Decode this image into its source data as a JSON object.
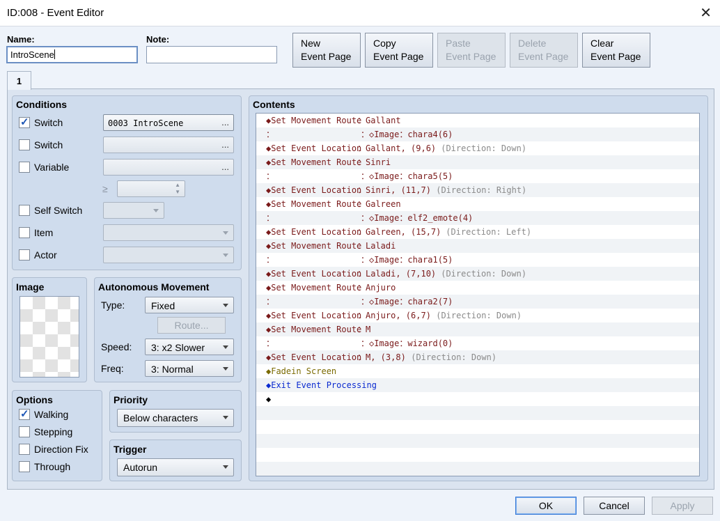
{
  "window": {
    "title": "ID:008 - Event Editor",
    "close_icon": "close-icon"
  },
  "header": {
    "name_label": "Name:",
    "name_value": "IntroScene",
    "note_label": "Note:",
    "note_value": "",
    "buttons": {
      "new": [
        "New",
        "Event Page"
      ],
      "copy": [
        "Copy",
        "Event Page"
      ],
      "paste": [
        "Paste",
        "Event Page"
      ],
      "delete": [
        "Delete",
        "Event Page"
      ],
      "clear": [
        "Clear",
        "Event Page"
      ]
    }
  },
  "tabs": [
    {
      "label": "1"
    }
  ],
  "conditions": {
    "title": "Conditions",
    "switch1": {
      "label": "Switch",
      "checked": true,
      "value": "0003 IntroScene"
    },
    "switch2": {
      "label": "Switch",
      "checked": false,
      "value": ""
    },
    "variable": {
      "label": "Variable",
      "checked": false,
      "value": "",
      "op": "≥",
      "number": ""
    },
    "self_switch": {
      "label": "Self Switch",
      "checked": false,
      "value": ""
    },
    "item": {
      "label": "Item",
      "checked": false,
      "value": ""
    },
    "actor": {
      "label": "Actor",
      "checked": false,
      "value": ""
    },
    "ellipsis": "..."
  },
  "image": {
    "title": "Image"
  },
  "autonomous": {
    "title": "Autonomous Movement",
    "type_label": "Type:",
    "type_value": "Fixed",
    "route_label": "Route...",
    "speed_label": "Speed:",
    "speed_value": "3: x2 Slower",
    "freq_label": "Freq:",
    "freq_value": "3: Normal"
  },
  "options": {
    "title": "Options",
    "walking": {
      "label": "Walking",
      "checked": true
    },
    "stepping": {
      "label": "Stepping",
      "checked": false
    },
    "direction_fix": {
      "label": "Direction Fix",
      "checked": false
    },
    "through": {
      "label": "Through",
      "checked": false
    }
  },
  "priority": {
    "title": "Priority",
    "value": "Below characters"
  },
  "trigger": {
    "title": "Trigger",
    "value": "Autorun"
  },
  "contents": {
    "title": "Contents",
    "rows": [
      {
        "a": "◆Set Movement Route",
        "b": "：Gallant",
        "c": "",
        "color": "red"
      },
      {
        "a": "：",
        "b": "：◇Image：chara4(6)",
        "c": "",
        "color": "red",
        "indent": true
      },
      {
        "a": "◆Set Event Location",
        "b": "：Gallant, (9,6)",
        "c": " (Direction: Down)",
        "color": "red"
      },
      {
        "a": "◆Set Movement Route",
        "b": "：Sinri",
        "c": "",
        "color": "red"
      },
      {
        "a": "：",
        "b": "：◇Image：chara5(5)",
        "c": "",
        "color": "red",
        "indent": true
      },
      {
        "a": "◆Set Event Location",
        "b": "：Sinri, (11,7)",
        "c": " (Direction: Right)",
        "color": "red"
      },
      {
        "a": "◆Set Movement Route",
        "b": "：Galreen",
        "c": "",
        "color": "red"
      },
      {
        "a": "：",
        "b": "：◇Image：elf2_emote(4)",
        "c": "",
        "color": "red",
        "indent": true
      },
      {
        "a": "◆Set Event Location",
        "b": "：Galreen, (15,7)",
        "c": " (Direction: Left)",
        "color": "red"
      },
      {
        "a": "◆Set Movement Route",
        "b": "：Laladi",
        "c": "",
        "color": "red"
      },
      {
        "a": "：",
        "b": "：◇Image：chara1(5)",
        "c": "",
        "color": "red",
        "indent": true
      },
      {
        "a": "◆Set Event Location",
        "b": "：Laladi, (7,10)",
        "c": " (Direction: Down)",
        "color": "red"
      },
      {
        "a": "◆Set Movement Route",
        "b": "：Anjuro",
        "c": "",
        "color": "red"
      },
      {
        "a": "：",
        "b": "：◇Image：chara2(7)",
        "c": "",
        "color": "red",
        "indent": true
      },
      {
        "a": "◆Set Event Location",
        "b": "：Anjuro, (6,7)",
        "c": " (Direction: Down)",
        "color": "red"
      },
      {
        "a": "◆Set Movement Route",
        "b": "：M",
        "c": "",
        "color": "red"
      },
      {
        "a": "：",
        "b": "：◇Image：wizard(0)",
        "c": "",
        "color": "red",
        "indent": true
      },
      {
        "a": "◆Set Event Location",
        "b": "：M, (3,8)",
        "c": " (Direction: Down)",
        "color": "red"
      },
      {
        "a": "◆Fadein Screen",
        "b": "",
        "c": "",
        "color": "olive"
      },
      {
        "a": "◆Exit Event Processing",
        "b": "",
        "c": "",
        "color": "blue"
      },
      {
        "a": "◆",
        "b": "",
        "c": "",
        "color": "black"
      },
      {
        "a": "",
        "b": "",
        "c": "",
        "color": "black"
      },
      {
        "a": "",
        "b": "",
        "c": "",
        "color": "black"
      },
      {
        "a": "",
        "b": "",
        "c": "",
        "color": "black"
      },
      {
        "a": "",
        "b": "",
        "c": "",
        "color": "black"
      },
      {
        "a": "",
        "b": "",
        "c": "",
        "color": "black"
      }
    ]
  },
  "footer": {
    "ok": "OK",
    "cancel": "Cancel",
    "apply": "Apply"
  }
}
